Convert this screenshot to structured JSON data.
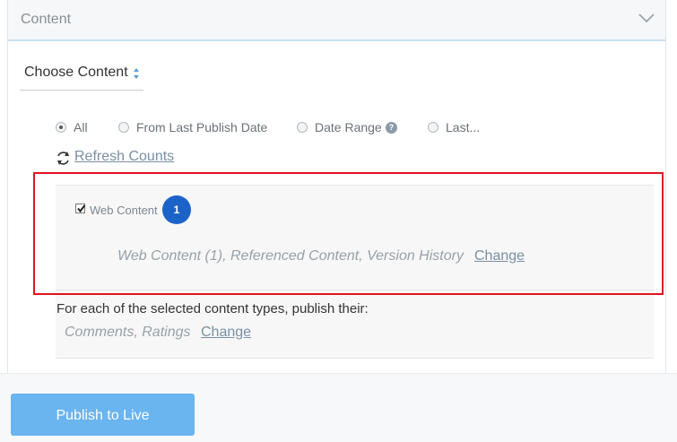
{
  "panel": {
    "title": "Content",
    "choose_content_label": "Choose Content"
  },
  "date_range_options": [
    {
      "label": "All",
      "selected": true
    },
    {
      "label": "From Last Publish Date",
      "selected": false
    },
    {
      "label": "Date Range",
      "selected": false,
      "help_icon": "?"
    },
    {
      "label": "Last...",
      "selected": false
    }
  ],
  "refresh": {
    "label": "Refresh Counts",
    "icon": "refresh-icon"
  },
  "web_content": {
    "checkbox_label": "Web Content",
    "checked": true,
    "badge": "1",
    "summary": "Web Content (1), Referenced Content, Version History",
    "change_label": "Change"
  },
  "related": {
    "heading": "For each of the selected content types, publish their:",
    "items": "Comments, Ratings",
    "change_label": "Change"
  },
  "footer": {
    "publish_label": "Publish to Live"
  },
  "colors": {
    "accent": "#6ab4ef",
    "badge": "#1c63c9",
    "highlight": "#e0141e",
    "link": "#7a8fa3"
  }
}
